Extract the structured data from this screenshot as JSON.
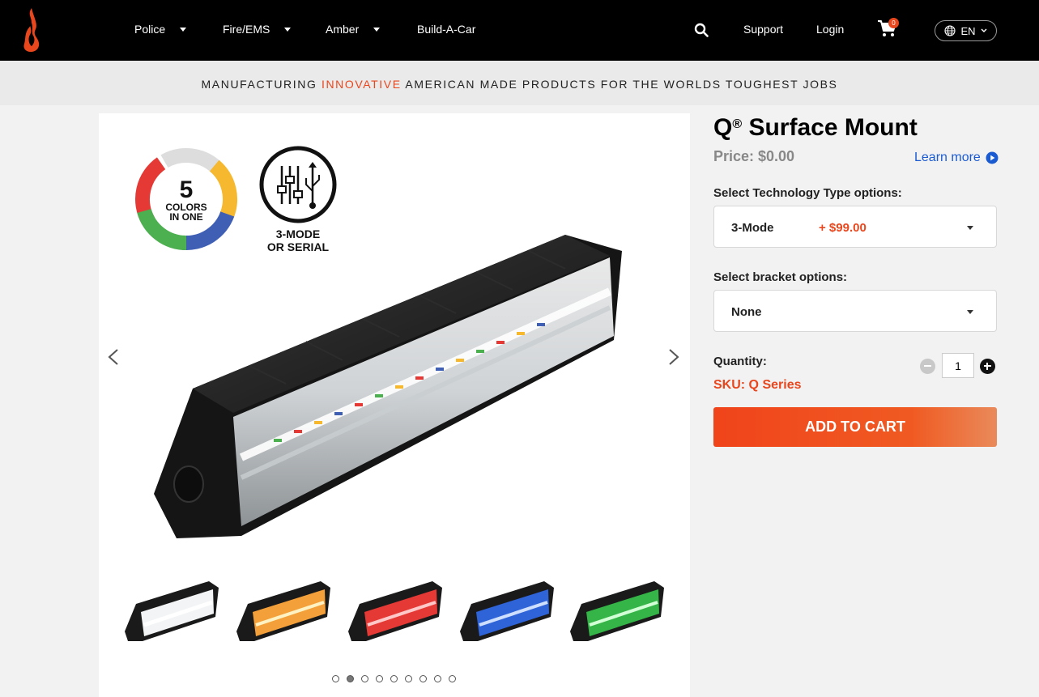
{
  "header": {
    "nav": [
      {
        "label": "Police"
      },
      {
        "label": "Fire/EMS"
      },
      {
        "label": "Amber"
      },
      {
        "label": "Build-A-Car"
      }
    ],
    "support_label": "Support",
    "login_label": "Login",
    "cart_count": "0",
    "language": "EN",
    "icons": [
      "flame-logo",
      "search-icon",
      "cart-icon",
      "globe-icon",
      "chevron-down-icon"
    ]
  },
  "banner": {
    "prefix": "MANUFACTURING",
    "accent": "INNOVATIVE",
    "suffix": "AMERICAN MADE PRODUCTS FOR THE WORLDS TOUGHEST JOBS"
  },
  "gallery": {
    "badge_five": {
      "number": "5",
      "line1": "COLORS",
      "line2": "IN ONE"
    },
    "badge_mode": {
      "line1": "3-MODE",
      "line2": "OR SERIAL"
    },
    "thumbnails": [
      "white",
      "amber",
      "red",
      "blue",
      "green"
    ],
    "dots_total": 9,
    "active_dot": 2
  },
  "product": {
    "title": "Q",
    "title_sup": "®",
    "title_rest": " Surface Mount",
    "price": "Price: $0.00",
    "learn_more": "Learn more",
    "technology_label": "Select Technology Type options:",
    "technology_value": "3-Mode",
    "technology_price": "+ $99.00",
    "bracket_label": "Select bracket options:",
    "bracket_value": "None",
    "quantity_label": "Quantity:",
    "quantity_value": "1",
    "sku": "SKU: Q Series",
    "add_to_cart": "ADD TO CART"
  },
  "colors": {
    "accent": "#e8471e",
    "link": "#1a5bd1",
    "header_bg": "#000000"
  }
}
